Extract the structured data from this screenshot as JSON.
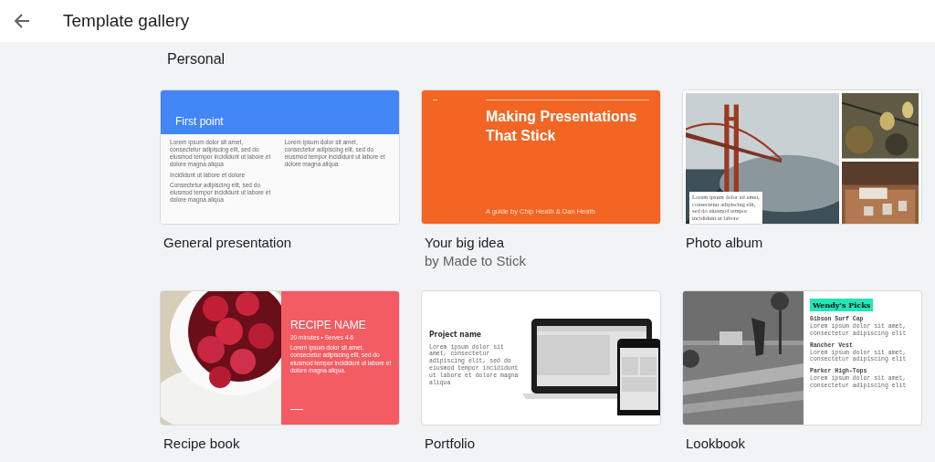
{
  "header": {
    "title": "Template gallery"
  },
  "section": {
    "title": "Personal",
    "templates": [
      {
        "kind": "general",
        "title": "General presentation",
        "slide": {
          "heading": "First point",
          "column_1": [
            "Lorem ipsum dolor sit amet, consectetur adipiscing elit, sed do eiusmod tempor incididunt ut labore et dolore magna aliqua",
            "Incididunt ut labore et dolore",
            "Consectetur adipiscing elit, sed do eiusmod tempor incididunt ut labore et dolore magna aliqua"
          ],
          "column_2": [
            "Lorem ipsum dolor sit amet, consectetur adipiscing elit, sed do eiusmod tempor incididunt ut labore et dolore magna aliqua"
          ]
        }
      },
      {
        "kind": "bigidea",
        "title": "Your big idea",
        "subtitle": "by Made to Stick",
        "slide": {
          "heading": "Making Presentations That Stick",
          "byline": "A guide by Chip Heath & Dan Heath"
        }
      },
      {
        "title": "Photo album",
        "slide": {
          "caption": "Lorem ipsum dolor sit amet, consectetur adipiscing elit, sed do eiusmod tempor incididunt ut labore"
        }
      },
      {
        "kind": "recipe",
        "title": "Recipe book",
        "slide": {
          "heading": "RECIPE NAME",
          "meta": "20 minutes • Serves 4-6",
          "body": "Lorem ipsum dolor sit amet, consectetur adipiscing elit, sed do eiusmod tempor incididunt ut labore et dolore magna aliqua."
        }
      },
      {
        "kind": "portfolio",
        "title": "Portfolio",
        "slide": {
          "heading": "Project name",
          "body": "Lorem ipsum dolor sit amet, consectetur adipiscing elit, sed do eiusmod tempor incididunt ut labore et dolore magna aliqua"
        }
      },
      {
        "kind": "lookbook",
        "title": "Lookbook",
        "slide": {
          "heading": "Wendy's Picks",
          "items": [
            {
              "name": "Gibson Surf Cap",
              "body": "Lorem ipsum dolor sit amet, consectetur adipiscing elit"
            },
            {
              "name": "Rancher Vest",
              "body": "Lorem ipsum dolor sit amet, consectetur adipiscing elit"
            },
            {
              "name": "Parker High-Tops",
              "body": "Lorem ipsum dolor sit amet, consectetur adipiscing elit"
            }
          ]
        }
      }
    ]
  }
}
